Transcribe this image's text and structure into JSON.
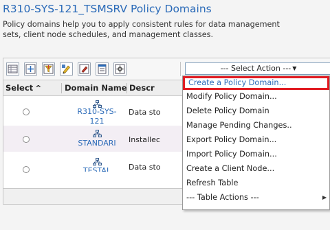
{
  "page": {
    "title": "R310-SYS-121_TSMSRV Policy Domains",
    "description_lines": [
      "Policy domains help you to apply consistent rules for data management",
      "sets, client node schedules, and management classes."
    ]
  },
  "toolbar": {
    "icons": [
      "table-icon",
      "expand-icon",
      "filter-icon",
      "edit-sort-icon",
      "edit-icon",
      "table-edit-icon",
      "settings-icon"
    ],
    "select_action": {
      "label": "--- Select Action ---",
      "arrow": "▼"
    }
  },
  "table": {
    "columns": [
      {
        "label": "Select",
        "sort": "^"
      },
      {
        "label": "Domain Name",
        "sort": "^"
      },
      {
        "label": "Descr"
      }
    ],
    "rows": [
      {
        "domain_name": "R310-SYS-121",
        "description": "Data sto"
      },
      {
        "domain_name": "STANDARI",
        "description": "Installec"
      },
      {
        "domain_name": "TESTAL",
        "description": "Data sto"
      }
    ]
  },
  "action_menu": {
    "items": [
      "Create a Policy Domain...",
      "Modify Policy Domain...",
      "Delete Policy Domain",
      "Manage Pending Changes..",
      "Export Policy Domain...",
      "Import Policy Domain...",
      "Create a Client Node...",
      "Refresh Table",
      "--- Table Actions ---"
    ],
    "highlighted_index": 0,
    "highlight_color": "#e11b22",
    "submenu_arrow": "▶"
  },
  "colors": {
    "accent": "#2a6ab8"
  }
}
